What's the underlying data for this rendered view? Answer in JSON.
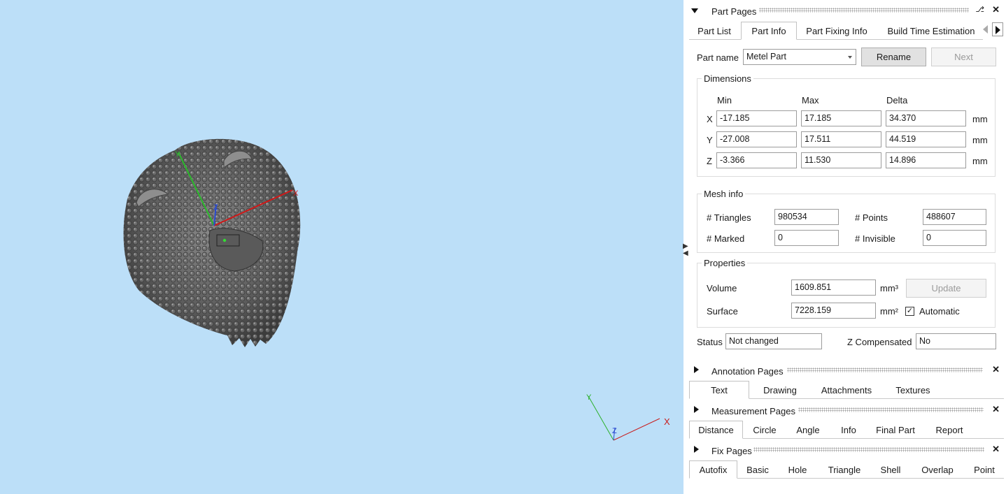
{
  "viewport": {
    "background": "#bcdff8",
    "axis_x": "X",
    "axis_y": "Y",
    "axis_z": "Z"
  },
  "part_pages": {
    "title": "Part Pages",
    "tabs": [
      "Part List",
      "Part Info",
      "Part Fixing Info",
      "Build Time Estimation"
    ],
    "part_name_label": "Part name",
    "part_name_value": "Metel Part",
    "rename_label": "Rename",
    "next_label": "Next",
    "dimensions": {
      "title": "Dimensions",
      "col_min": "Min",
      "col_max": "Max",
      "col_delta": "Delta",
      "rows": [
        {
          "axis": "X",
          "min": "-17.185",
          "max": "17.185",
          "delta": "34.370",
          "unit": "mm"
        },
        {
          "axis": "Y",
          "min": "-27.008",
          "max": "17.511",
          "delta": "44.519",
          "unit": "mm"
        },
        {
          "axis": "Z",
          "min": "-3.366",
          "max": "11.530",
          "delta": "14.896",
          "unit": "mm"
        }
      ]
    },
    "mesh": {
      "title": "Mesh info",
      "triangles_label": "# Triangles",
      "triangles": "980534",
      "points_label": "# Points",
      "points": "488607",
      "marked_label": "# Marked",
      "marked": "0",
      "invisible_label": "# Invisible",
      "invisible": "0"
    },
    "properties": {
      "title": "Properties",
      "volume_label": "Volume",
      "volume": "1609.851",
      "volume_unit": "mm³",
      "update_label": "Update",
      "surface_label": "Surface",
      "surface": "7228.159",
      "surface_unit": "mm²",
      "automatic_label": "Automatic",
      "automatic_checked": "✓"
    },
    "status_label": "Status",
    "status_value": "Not changed",
    "zcomp_label": "Z Compensated",
    "zcomp_value": "No"
  },
  "annotation_pages": {
    "title": "Annotation Pages",
    "tabs": [
      "Text",
      "Drawing",
      "Attachments",
      "Textures"
    ]
  },
  "measurement_pages": {
    "title": "Measurement Pages",
    "tabs": [
      "Distance",
      "Circle",
      "Angle",
      "Info",
      "Final Part",
      "Report"
    ]
  },
  "fix_pages": {
    "title": "Fix Pages",
    "tabs": [
      "Autofix",
      "Basic",
      "Hole",
      "Triangle",
      "Shell",
      "Overlap",
      "Point"
    ]
  }
}
